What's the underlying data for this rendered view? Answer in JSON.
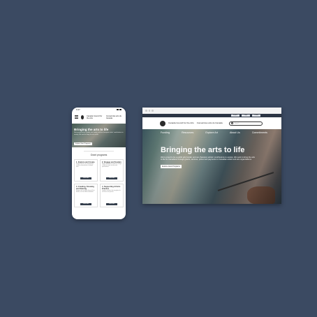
{
  "phone": {
    "status_time": "9:47",
    "brand_en": "Canada Council for the Arts",
    "brand_fr": "Conseil des arts du Canada",
    "hero": {
      "title": "Bringing the arts to life",
      "body": "We're proud to be a public arts funder, and we champion artists' contributions to society. We work to bring the arts to life.",
      "button": "Explore Grant Programs"
    },
    "section_title": "Grant programs",
    "cards": [
      {
        "title": "1. Explore and Create",
        "body": "Supports artists in the development, creation and production of original work.",
        "button": "Learn More"
      },
      {
        "title": "2. Engage and Sustain",
        "body": "Engage with diverse audiences through a range of artistic activities and presentations.",
        "button": "Learn More"
      },
      {
        "title": "3. Creating, Knowing and Sharing",
        "body": "Supports the arts and cultures of First Nations, Inuit and Métis individuals.",
        "button": "Learn More"
      },
      {
        "title": "4. Supporting Artistic Practice",
        "body": "Supports activities that strengthen the arts sector and practice.",
        "button": "Learn More"
      }
    ]
  },
  "browser": {
    "util_links": [
      "English",
      "Login",
      "Contact"
    ],
    "brand_en": "Canada Council for the Arts",
    "brand_fr": "Conseil des arts du Canada",
    "search_placeholder": "Search",
    "nav": [
      "Funding",
      "Resources",
      "Explore Art",
      "About Us",
      "Commitments"
    ],
    "hero": {
      "title": "Bringing the arts to life",
      "body": "We're proud to be a public arts funder, and we champion artists' contributions to society. We work to bring the arts to life for Canadians through grants, services, prizes and payments to Canadian artists and arts organizations.",
      "button": "Explore Grant Programs"
    }
  }
}
